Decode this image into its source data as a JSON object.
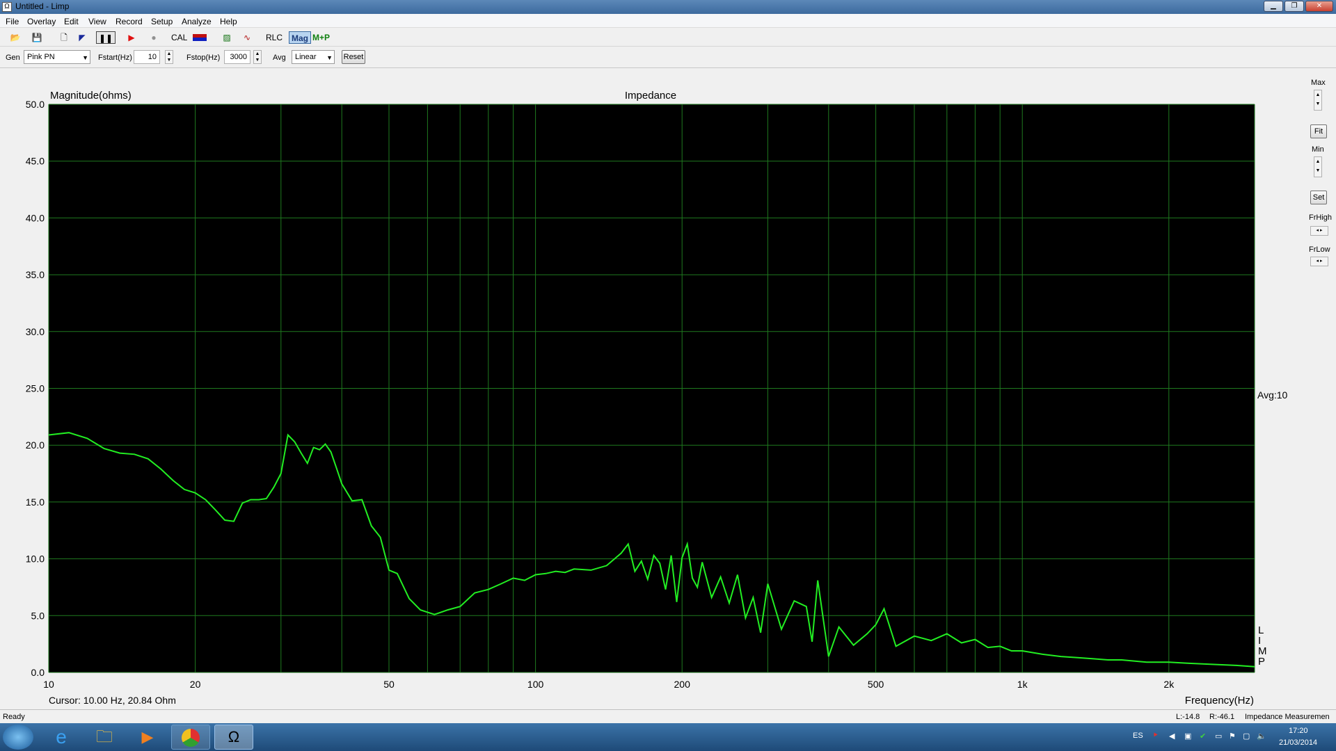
{
  "window": {
    "title": "Untitled - Limp",
    "title_icon": "limp-app-icon"
  },
  "menu": [
    "File",
    "Overlay",
    "Edit",
    "View",
    "Record",
    "Setup",
    "Analyze",
    "Help"
  ],
  "toolbar": {
    "cal_label": "CAL",
    "rlc_label": "RLC",
    "mag_label": "Mag",
    "mp_label": "M+P"
  },
  "controls": {
    "gen_label": "Gen",
    "gen_value": "Pink PN",
    "fstart_label": "Fstart(Hz)",
    "fstart_value": "10",
    "fstop_label": "Fstop(Hz)",
    "fstop_value": "3000",
    "avg_label": "Avg",
    "avg_value": "Linear",
    "reset_label": "Reset"
  },
  "right_panel": {
    "max_label": "Max",
    "fit_label": "Fit",
    "min_label": "Min",
    "set_label": "Set",
    "frhigh_label": "FrHigh",
    "frlow_label": "FrLow"
  },
  "overlay": {
    "avg_text": "Avg:10",
    "cursor_text": "Cursor: 10.00 Hz, 20.84 Ohm",
    "side_letters": [
      "L",
      "I",
      "M",
      "P"
    ]
  },
  "status": {
    "left": "Ready",
    "l_value": "L:-14.8",
    "r_value": "R:-46.1",
    "mode": "Impedance Measuremen"
  },
  "tray": {
    "lang": "ES",
    "time": "17:20",
    "date": "21/03/2014"
  },
  "colors": {
    "plot_bg": "#000000",
    "grid": "#1f7a1f",
    "trace": "#22ee22",
    "title_bar": "#4a78aa"
  },
  "chart_data": {
    "type": "line",
    "title": "Impedance",
    "xlabel": "Frequency(Hz)",
    "ylabel": "Magnitude(ohms)",
    "xscale": "log",
    "xlim": [
      10,
      3000
    ],
    "ylim": [
      0,
      50
    ],
    "yticks": [
      "0.0",
      "5.0",
      "10.0",
      "15.0",
      "20.0",
      "25.0",
      "30.0",
      "35.0",
      "40.0",
      "45.0",
      "50.0"
    ],
    "xtick_values": [
      10,
      20,
      50,
      100,
      200,
      500,
      1000,
      2000
    ],
    "xtick_labels": [
      "10",
      "20",
      "50",
      "100",
      "200",
      "500",
      "1k",
      "2k"
    ],
    "grid": true,
    "series": [
      {
        "x": [
          10,
          11,
          12,
          13,
          14,
          15,
          16,
          17,
          18,
          19,
          20,
          21,
          22,
          23,
          24,
          25,
          26,
          27,
          28,
          29,
          30,
          31,
          32,
          33,
          34,
          35,
          36,
          37,
          38,
          39,
          40,
          42,
          44,
          46,
          48,
          50,
          52,
          55,
          58,
          62,
          66,
          70,
          75,
          80,
          85,
          90,
          95,
          100,
          105,
          110,
          115,
          120,
          130,
          140,
          150,
          155,
          160,
          165,
          170,
          175,
          180,
          185,
          190,
          195,
          200,
          205,
          210,
          215,
          220,
          230,
          240,
          250,
          260,
          270,
          280,
          290,
          300,
          320,
          340,
          360,
          370,
          380,
          400,
          420,
          450,
          480,
          500,
          520,
          550,
          600,
          650,
          700,
          750,
          800,
          850,
          900,
          950,
          1000,
          1100,
          1200,
          1300,
          1400,
          1500,
          1600,
          1800,
          2000,
          2200,
          2500,
          2800,
          3000
        ],
        "y": [
          20.9,
          21.1,
          20.6,
          19.7,
          19.3,
          19.2,
          18.8,
          17.9,
          16.9,
          16.1,
          15.8,
          15.2,
          14.3,
          13.4,
          13.3,
          14.9,
          15.2,
          15.2,
          15.3,
          16.3,
          17.5,
          20.9,
          20.3,
          19.3,
          18.4,
          19.8,
          19.6,
          20.1,
          19.4,
          18.0,
          16.6,
          15.1,
          15.2,
          12.9,
          11.9,
          9.0,
          8.7,
          6.5,
          5.5,
          5.1,
          5.5,
          5.8,
          7.0,
          7.3,
          7.8,
          8.3,
          8.1,
          8.6,
          8.7,
          8.9,
          8.8,
          9.1,
          9.0,
          9.4,
          10.5,
          11.3,
          8.9,
          9.8,
          8.2,
          10.3,
          9.6,
          7.3,
          10.3,
          6.2,
          10.1,
          11.3,
          8.3,
          7.5,
          9.7,
          6.6,
          8.4,
          6.1,
          8.6,
          4.8,
          6.6,
          3.5,
          7.8,
          3.8,
          6.3,
          5.8,
          2.7,
          8.1,
          1.4,
          4.0,
          2.4,
          3.4,
          4.2,
          5.6,
          2.3,
          3.2,
          2.8,
          3.4,
          2.6,
          2.9,
          2.2,
          2.3,
          1.9,
          1.9,
          1.6,
          1.4,
          1.3,
          1.2,
          1.1,
          1.1,
          0.9,
          0.9,
          0.8,
          0.7,
          0.6,
          0.5
        ]
      }
    ]
  }
}
